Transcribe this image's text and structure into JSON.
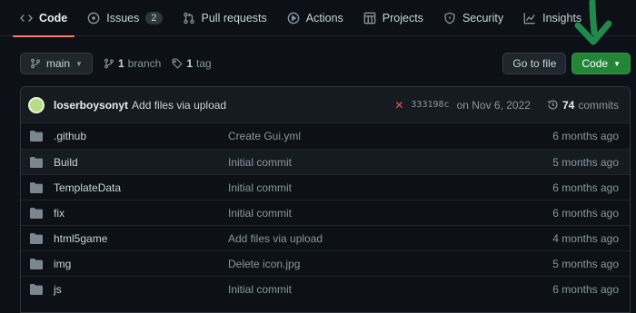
{
  "tabs": [
    {
      "label": "Code",
      "icon": "code-icon",
      "active": true
    },
    {
      "label": "Issues",
      "icon": "issue-icon",
      "count": "2"
    },
    {
      "label": "Pull requests",
      "icon": "pull-request-icon"
    },
    {
      "label": "Actions",
      "icon": "play-icon"
    },
    {
      "label": "Projects",
      "icon": "table-icon"
    },
    {
      "label": "Security",
      "icon": "shield-icon"
    },
    {
      "label": "Insights",
      "icon": "graph-icon"
    }
  ],
  "toolbar": {
    "branch": "main",
    "branch_count": "1",
    "branch_label": "branch",
    "tag_count": "1",
    "tag_label": "tag",
    "go_to_file": "Go to file",
    "code": "Code"
  },
  "commit": {
    "user": "loserboysonyt",
    "message": "Add files via upload",
    "status": "✕",
    "sha": "333198c",
    "date": "on Nov 6, 2022",
    "count": "74",
    "count_label": "commits"
  },
  "files": [
    {
      "name": ".github",
      "message": "Create Gui.yml",
      "age": "6 months ago"
    },
    {
      "name": "Build",
      "message": "Initial commit",
      "age": "5 months ago"
    },
    {
      "name": "TemplateData",
      "message": "Initial commit",
      "age": "6 months ago"
    },
    {
      "name": "fix",
      "message": "Initial commit",
      "age": "6 months ago"
    },
    {
      "name": "html5game",
      "message": "Add files via upload",
      "age": "4 months ago"
    },
    {
      "name": "img",
      "message": "Delete icon.jpg",
      "age": "5 months ago"
    },
    {
      "name": "js",
      "message": "Initial commit",
      "age": "6 months ago"
    }
  ],
  "colors": {
    "background": "#0d1117",
    "accent_green": "#238636",
    "active_tab": "#f78166",
    "folder": "#7d8590",
    "annotation_arrow": "#1f8a4c"
  }
}
